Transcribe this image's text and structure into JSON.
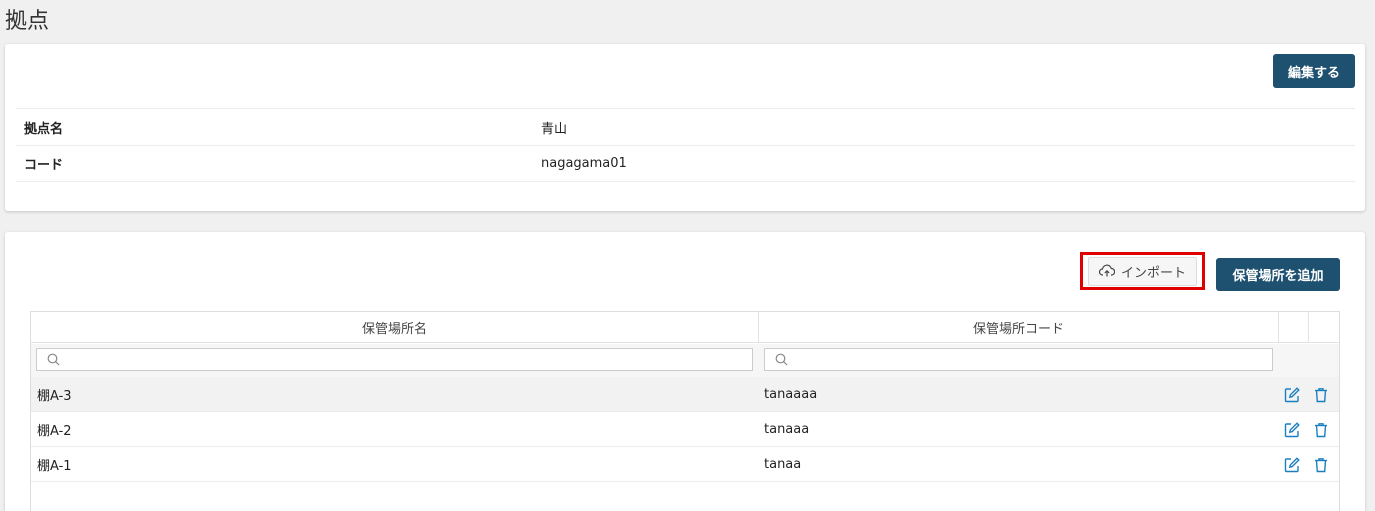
{
  "page": {
    "title": "拠点"
  },
  "detail": {
    "edit_label": "編集する",
    "rows": [
      {
        "label": "拠点名",
        "value": "青山"
      },
      {
        "label": "コード",
        "value": "nagagama01"
      }
    ]
  },
  "storage": {
    "import_label": "インポート",
    "add_label": "保管場所を追加",
    "columns": [
      "保管場所名",
      "保管場所コード"
    ],
    "filters": {
      "name_placeholder": "",
      "code_placeholder": ""
    },
    "rows": [
      {
        "name": "棚A-3",
        "code": "tanaaaa"
      },
      {
        "name": "棚A-2",
        "code": "tanaaa"
      },
      {
        "name": "棚A-1",
        "code": "tanaa"
      }
    ]
  },
  "icons": {
    "import": "cloud-upload-icon",
    "search": "search-icon",
    "edit": "edit-icon",
    "delete": "trash-icon"
  },
  "colors": {
    "primary": "#1e5070",
    "action_icon": "#1a7fc1",
    "highlight": "#e00000"
  }
}
